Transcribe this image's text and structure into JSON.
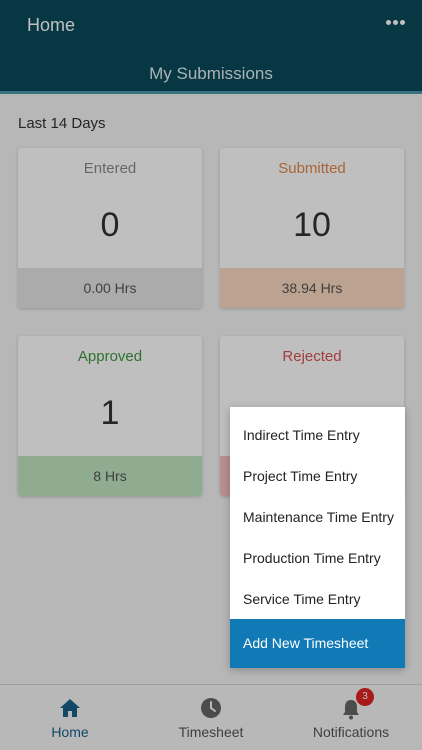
{
  "header": {
    "title": "Home",
    "subtitle": "My Submissions",
    "more_icon": "more-horizontal-icon"
  },
  "period_label": "Last 14 Days",
  "cards": [
    {
      "label": "Entered",
      "count": "0",
      "hours": "0.00 Hrs",
      "color": "#8a8a8a"
    },
    {
      "label": "Submitted",
      "count": "10",
      "hours": "38.94 Hrs",
      "color": "#e0874a"
    },
    {
      "label": "Approved",
      "count": "1",
      "hours": "8 Hrs",
      "color": "#3c9a3f"
    },
    {
      "label": "Rejected",
      "count": "",
      "hours": "",
      "color": "#d9534f"
    }
  ],
  "menu": {
    "items": [
      "Indirect Time Entry",
      "Project Time Entry",
      "Maintenance Time Entry",
      "Production Time Entry",
      "Service Time Entry"
    ],
    "primary": "Add New Timesheet"
  },
  "nav": {
    "items": [
      {
        "label": "Home",
        "icon": "home-icon",
        "active": true
      },
      {
        "label": "Timesheet",
        "icon": "clock-icon",
        "active": false
      },
      {
        "label": "Notifications",
        "icon": "bell-icon",
        "active": false,
        "badge": "3"
      }
    ]
  },
  "colors": {
    "header": "#0a4a5a",
    "accent": "#1079b6",
    "active_nav": "#1a5f8a",
    "badge": "#e02424"
  }
}
